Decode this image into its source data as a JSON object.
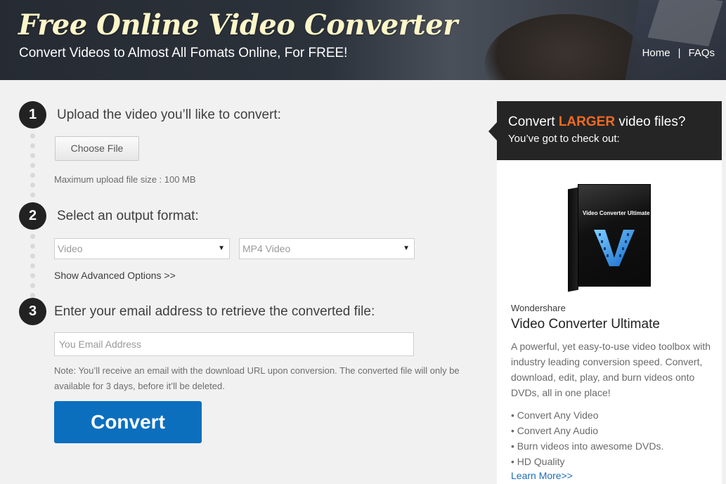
{
  "header": {
    "title": "Free Online Video Converter",
    "subtitle": "Convert Videos to Almost All Fomats Online, For FREE!",
    "nav": [
      {
        "label": "Home"
      },
      {
        "label": "FAQs"
      }
    ],
    "nav_separator": "|"
  },
  "steps": [
    {
      "number": "1",
      "title": "Upload the video you’ll like to convert:"
    },
    {
      "number": "2",
      "title": "Select an output format:"
    },
    {
      "number": "3",
      "title": "Enter your email address to retrieve the converted file:"
    }
  ],
  "upload": {
    "button_label": "Choose File",
    "max_size_text": "Maximum upload file size : 100 MB"
  },
  "format": {
    "category_selected": "Video",
    "format_selected": "MP4 Video",
    "advanced_link": "Show Advanced Options >>"
  },
  "email": {
    "placeholder": "You Email Address",
    "note": "Note: You’ll receive an email with the download URL upon conversion. The converted file will only be available for 3 days, before it’ll be deleted."
  },
  "convert_button": "Convert",
  "sidebar": {
    "headline_prefix": "Convert ",
    "headline_highlight": "LARGER",
    "headline_suffix": " video files?",
    "subheadline": "You’ve got to check out:",
    "highlight_color": "#f06a22",
    "product_box_text": "Video Converter Ultimate",
    "brand": "Wondershare",
    "product_name": "Video Converter Ultimate",
    "description": "A powerful, yet easy-to-use video toolbox with industry leading conversion speed. Convert, download, edit, play, and burn videos onto DVDs, all in one place!",
    "features": [
      "Convert Any Video",
      "Convert Any Audio",
      "Burn videos into awesome DVDs.",
      "HD Quality"
    ],
    "learn_more": "Learn More>>"
  },
  "colors": {
    "accent_blue": "#0b6fbe",
    "link_blue": "#1f6db8",
    "step_circle": "#222222"
  }
}
